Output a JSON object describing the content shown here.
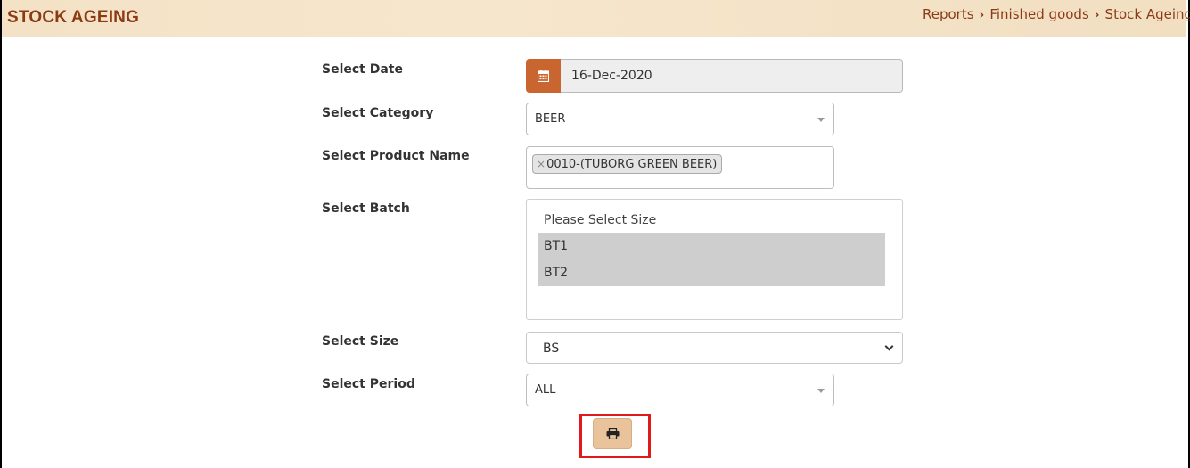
{
  "header": {
    "title": "STOCK AGEING",
    "breadcrumb": [
      "Reports",
      "Finished goods",
      "Stock Ageing"
    ]
  },
  "form": {
    "date": {
      "label": "Select Date",
      "value": "16-Dec-2020",
      "icon": "calendar-icon"
    },
    "category": {
      "label": "Select Category",
      "value": "BEER"
    },
    "product": {
      "label": "Select Product Name",
      "selected_tag": "0010-(TUBORG GREEN BEER)"
    },
    "batch": {
      "label": "Select Batch",
      "options": [
        "Please Select Size",
        "BT1",
        "BT2"
      ],
      "selected": [
        "BT1",
        "BT2"
      ]
    },
    "size": {
      "label": "Select Size",
      "value": "BS"
    },
    "period": {
      "label": "Select Period",
      "value": "ALL"
    },
    "print_button": {
      "icon": "print-icon"
    }
  },
  "colors": {
    "title": "#8a3b14",
    "calendar_addon": "#c9652e",
    "print_button": "#e9c39c",
    "highlight": "#e0191b"
  }
}
